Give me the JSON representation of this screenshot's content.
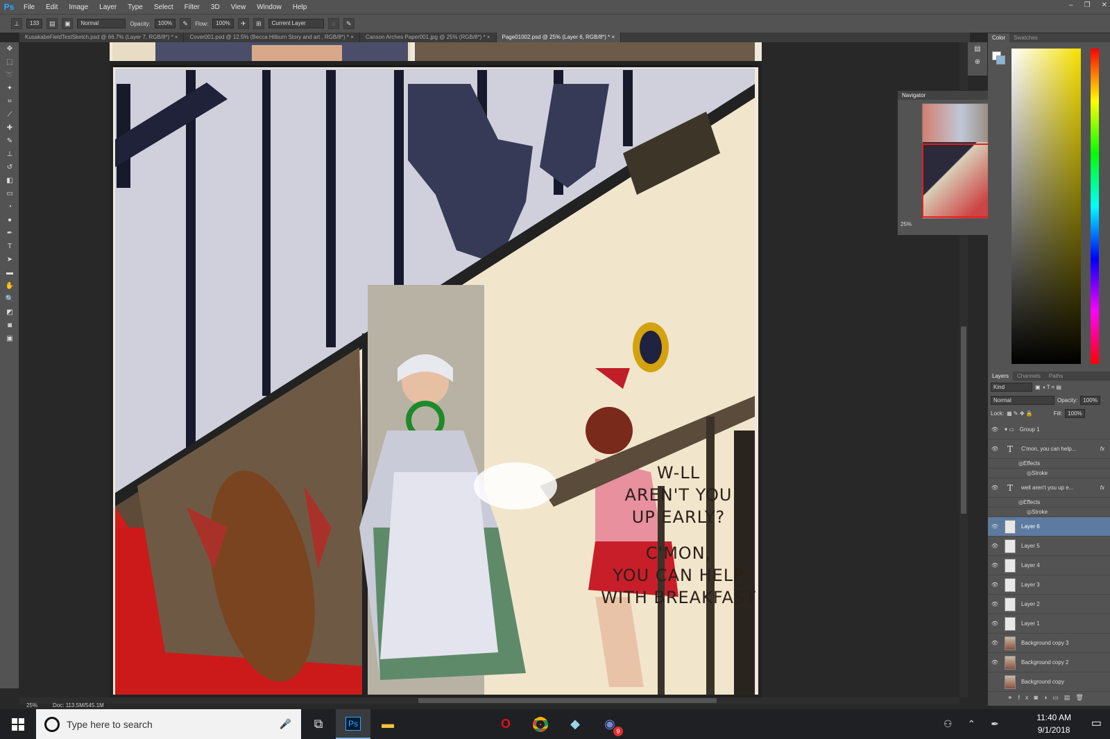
{
  "app": {
    "logo": "Ps",
    "menu": [
      "File",
      "Edit",
      "Image",
      "Layer",
      "Type",
      "Select",
      "Filter",
      "3D",
      "View",
      "Window",
      "Help"
    ]
  },
  "window_controls": {
    "minimize": "–",
    "restore": "❐",
    "close": "✕"
  },
  "options": {
    "brush_size": "133",
    "mode": "Normal",
    "opacity_label": "Opacity:",
    "opacity": "100%",
    "flow_label": "Flow:",
    "flow": "100%",
    "sample": "Current Layer"
  },
  "tabs": [
    "KusakabeFieldTestSketch.psd @ 66.7% (Layer 7, RGB/8*) *",
    "Cover001.psd @ 12.5% (Becca Hilburn Story and art , RGB/8*) *",
    "Canson Arches Paper001.jpg @ 25% (RGB/8*) *",
    "Page01002.psd @ 25% (Layer 6, RGB/8*) *"
  ],
  "active_tab_index": 3,
  "canvas": {
    "speech_lines": [
      "W-LL",
      "AREN'T YOU",
      "UP EARLY?",
      "",
      "C'MON,",
      "YOU CAN HELP",
      "WITH BREAKFAST"
    ]
  },
  "status": {
    "zoom": "25%",
    "doc": "Doc: 113.5M/545.1M"
  },
  "navigator": {
    "title": "Navigator",
    "zoom": "25%"
  },
  "color_panel": {
    "tabs": [
      "Color",
      "Swatches"
    ]
  },
  "layers_panel": {
    "tabs": [
      "Layers",
      "Channels",
      "Paths"
    ],
    "kind": "Kind",
    "blend": "Normal",
    "opacity_label": "Opacity:",
    "opacity": "100%",
    "lock_label": "Lock:",
    "fill_label": "Fill:",
    "fill": "100%",
    "rows": [
      {
        "name": "Group 1",
        "type": "group"
      },
      {
        "name": "C'mon, you can help...",
        "type": "text",
        "fx": "fx"
      },
      {
        "name": "Effects",
        "type": "sub"
      },
      {
        "name": "Stroke",
        "type": "sub2"
      },
      {
        "name": "well aren't you up e...",
        "type": "text",
        "fx": "fx"
      },
      {
        "name": "Effects",
        "type": "sub"
      },
      {
        "name": "Stroke",
        "type": "sub2"
      },
      {
        "name": "Layer 6",
        "type": "layer",
        "active": true
      },
      {
        "name": "Layer 5",
        "type": "layer"
      },
      {
        "name": "Layer 4",
        "type": "layer"
      },
      {
        "name": "Layer 3",
        "type": "layer"
      },
      {
        "name": "Layer 2",
        "type": "layer"
      },
      {
        "name": "Layer 1",
        "type": "layer"
      },
      {
        "name": "Background copy 3",
        "type": "image"
      },
      {
        "name": "Background copy 2",
        "type": "image"
      },
      {
        "name": "Background copy",
        "type": "image"
      }
    ]
  },
  "taskbar": {
    "search_placeholder": "Type here to search",
    "time": "11:40 AM",
    "date": "9/1/2018",
    "discord_badge": "9"
  }
}
